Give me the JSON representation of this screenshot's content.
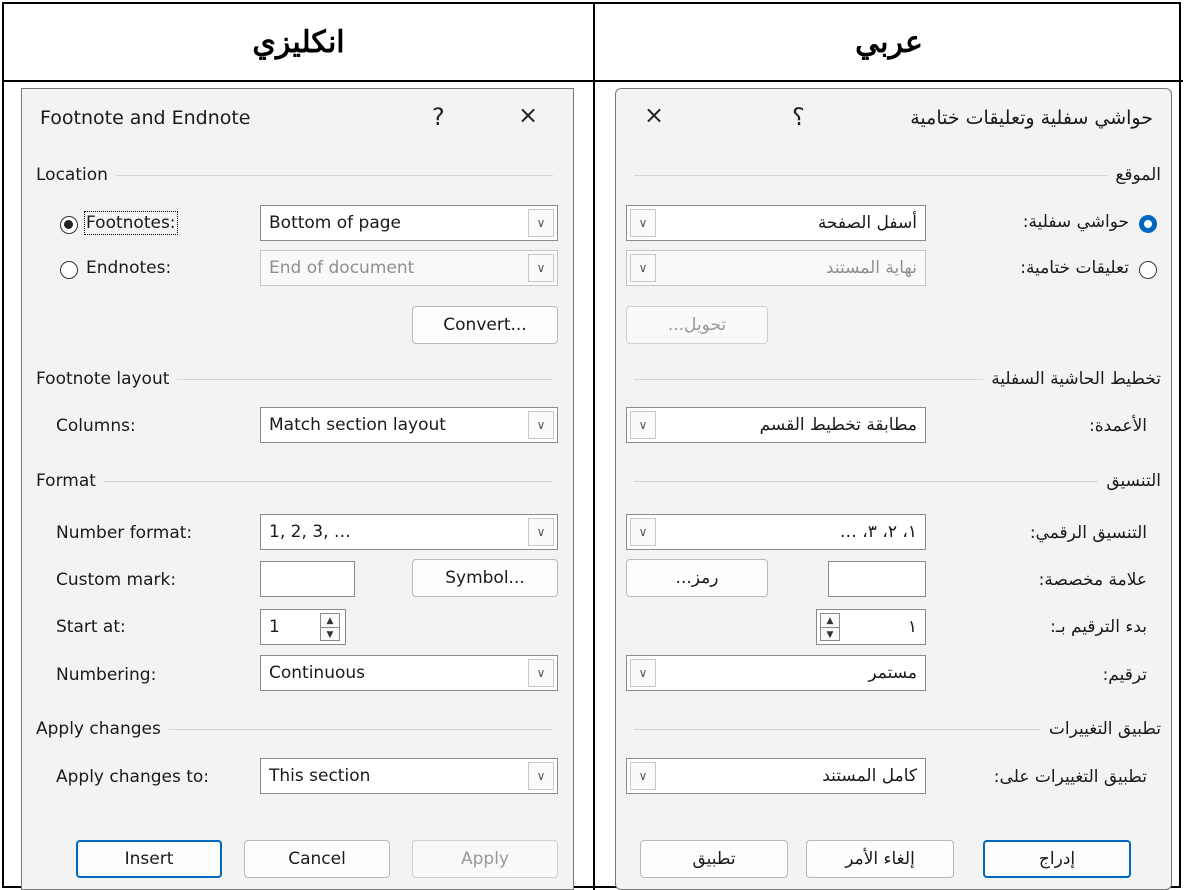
{
  "headers": {
    "left": "انكليزي",
    "right": "عربي"
  },
  "english": {
    "title": "Footnote and Endnote",
    "help": "?",
    "close": "×",
    "location": {
      "heading": "Location",
      "footnotes_label": "Footnotes:",
      "footnotes_value": "Bottom of page",
      "endnotes_label": "Endnotes:",
      "endnotes_value": "End of document",
      "convert": "Convert..."
    },
    "layout": {
      "heading": "Footnote layout",
      "columns_label": "Columns:",
      "columns_value": "Match section layout"
    },
    "format": {
      "heading": "Format",
      "number_format_label": "Number format:",
      "number_format_value": "1, 2, 3, …",
      "custom_mark_label": "Custom mark:",
      "custom_mark_value": "",
      "symbol": "Symbol...",
      "start_at_label": "Start at:",
      "start_at_value": "1",
      "numbering_label": "Numbering:",
      "numbering_value": "Continuous"
    },
    "apply": {
      "heading": "Apply changes",
      "apply_to_label": "Apply changes to:",
      "apply_to_value": "This section"
    },
    "buttons": {
      "insert": "Insert",
      "cancel": "Cancel",
      "apply": "Apply"
    }
  },
  "arabic": {
    "title": "حواشي سفلية وتعليقات ختامية",
    "help": "؟",
    "close": "×",
    "location": {
      "heading": "الموقع",
      "footnotes_label": "حواشي سفلية:",
      "footnotes_value": "أسفل الصفحة",
      "endnotes_label": "تعليقات ختامية:",
      "endnotes_value": "نهاية المستند",
      "convert": "تحويل..."
    },
    "layout": {
      "heading": "تخطيط الحاشية السفلية",
      "columns_label": "الأعمدة:",
      "columns_value": "مطابقة تخطيط القسم"
    },
    "format": {
      "heading": "التنسيق",
      "number_format_label": "التنسيق الرقمي:",
      "number_format_value": "١، ٢، ٣، …",
      "custom_mark_label": "علامة مخصصة:",
      "custom_mark_value": "",
      "symbol": "رمز...",
      "start_at_label": "بدء الترقيم بـ:",
      "start_at_value": "١",
      "numbering_label": "ترقيم:",
      "numbering_value": "مستمر"
    },
    "apply": {
      "heading": "تطبيق التغييرات",
      "apply_to_label": "تطبيق التغييرات على:",
      "apply_to_value": "كامل المستند"
    },
    "buttons": {
      "insert": "إدراج",
      "cancel": "إلغاء الأمر",
      "apply": "تطبيق"
    }
  },
  "colors": {
    "accent": "#0067c0",
    "dialog_bg": "#f3f3f3",
    "border": "#000000"
  },
  "icons": {
    "dropdown": "chevron-down-icon",
    "radio": "radio-icon",
    "spinner": "spinner-icon"
  }
}
